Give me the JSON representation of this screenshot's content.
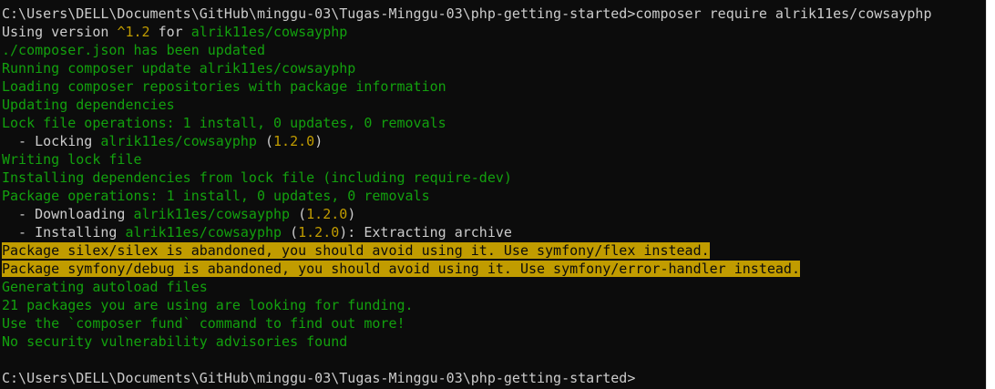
{
  "terminal": {
    "prompt_command": {
      "prompt": "C:\\Users\\DELL\\Documents\\GitHub\\minggu-03\\Tugas-Minggu-03\\php-getting-started>",
      "command": "composer require alrik11es/cowsayphp"
    },
    "using_version": {
      "prefix": "Using version ",
      "version": "^1.2",
      "mid": " for ",
      "package": "alrik11es/cowsayphp"
    },
    "lines_block1": [
      "./composer.json has been updated",
      "Running composer update alrik11es/cowsayphp",
      "Loading composer repositories with package information",
      "Updating dependencies",
      "Lock file operations: 1 install, 0 updates, 0 removals"
    ],
    "locking": {
      "prefix": "  - Locking ",
      "package": "alrik11es/cowsayphp",
      "open": " (",
      "version": "1.2.0",
      "close": ")"
    },
    "lines_block2": [
      "Writing lock file",
      "Installing dependencies from lock file (including require-dev)",
      "Package operations: 1 install, 0 updates, 0 removals"
    ],
    "downloading": {
      "prefix": "  - Downloading ",
      "package": "alrik11es/cowsayphp",
      "open": " (",
      "version": "1.2.0",
      "close": ")"
    },
    "installing": {
      "prefix": "  - Installing ",
      "package": "alrik11es/cowsayphp",
      "open": " (",
      "version": "1.2.0",
      "close": "): Extracting archive"
    },
    "warnings": [
      "Package silex/silex is abandoned, you should avoid using it. Use symfony/flex instead.",
      "Package symfony/debug is abandoned, you should avoid using it. Use symfony/error-handler instead."
    ],
    "lines_block3": [
      "Generating autoload files",
      "21 packages you are using are looking for funding.",
      "Use the `composer fund` command to find out more!",
      "No security vulnerability advisories found"
    ],
    "final_prompt": "C:\\Users\\DELL\\Documents\\GitHub\\minggu-03\\Tugas-Minggu-03\\php-getting-started>"
  },
  "colors": {
    "background": "#0c0c0c",
    "foreground": "#cccccc",
    "green": "#13a10e",
    "yellow": "#c19c00"
  }
}
